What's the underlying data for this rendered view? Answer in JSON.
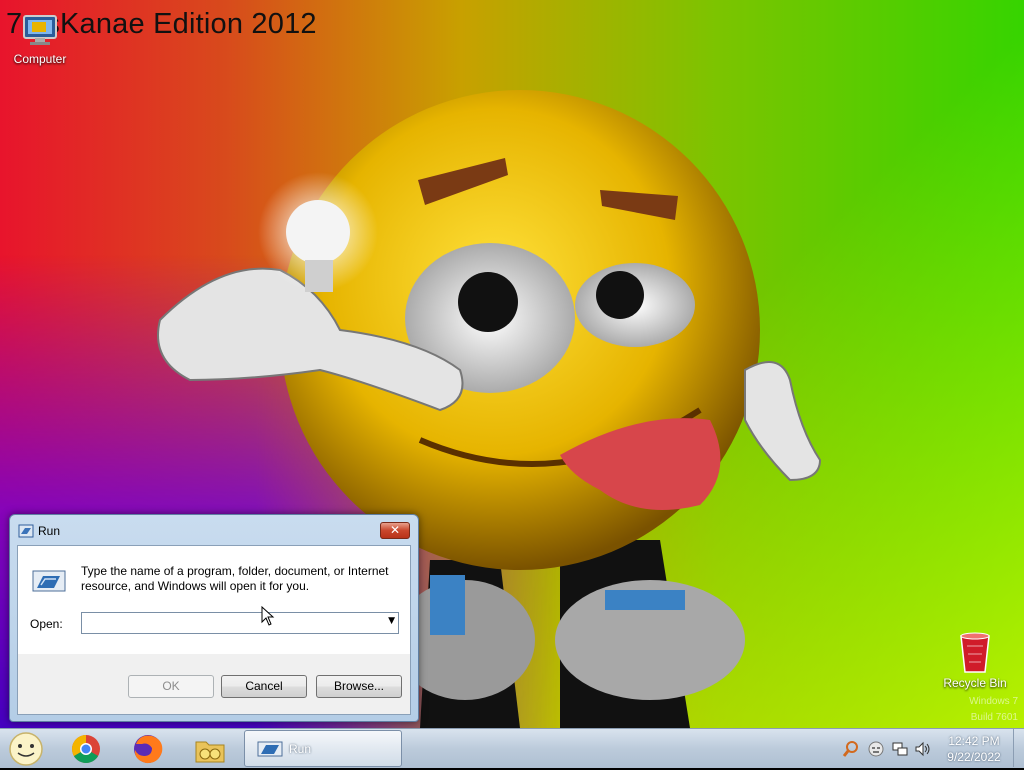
{
  "desktop": {
    "wallpaper_title": "7 ssKanae Edition 2012",
    "watermark_lines": [
      "Windows 7",
      "Build 7601"
    ],
    "icons": [
      {
        "label": "Computer",
        "icon": "computer-icon"
      },
      {
        "label": "Recycle Bin",
        "icon": "recycle-bin-icon"
      }
    ]
  },
  "run_dialog": {
    "title": "Run",
    "close_glyph": "✕",
    "description": "Type the name of a program, folder, document, or Internet resource, and Windows will open it for you.",
    "open_label": "Open:",
    "open_value": "",
    "buttons": {
      "ok": "OK",
      "cancel": "Cancel",
      "browse": "Browse..."
    }
  },
  "taskbar": {
    "start_icon": "smiley-orb-icon",
    "pinned": [
      "chrome-icon",
      "firefox-icon",
      "explorer-icon"
    ],
    "active_task": {
      "label": "Run",
      "icon": "run-icon"
    },
    "tray_icons": [
      "search-icon",
      "emoji-icon",
      "network-icon",
      "volume-icon"
    ],
    "clock": {
      "time": "12:42 PM",
      "date": "9/22/2022"
    }
  },
  "colors": {
    "taskbar": "#bccbdb",
    "dialog_frame": "#b4cde6",
    "close_button": "#c9462c"
  }
}
